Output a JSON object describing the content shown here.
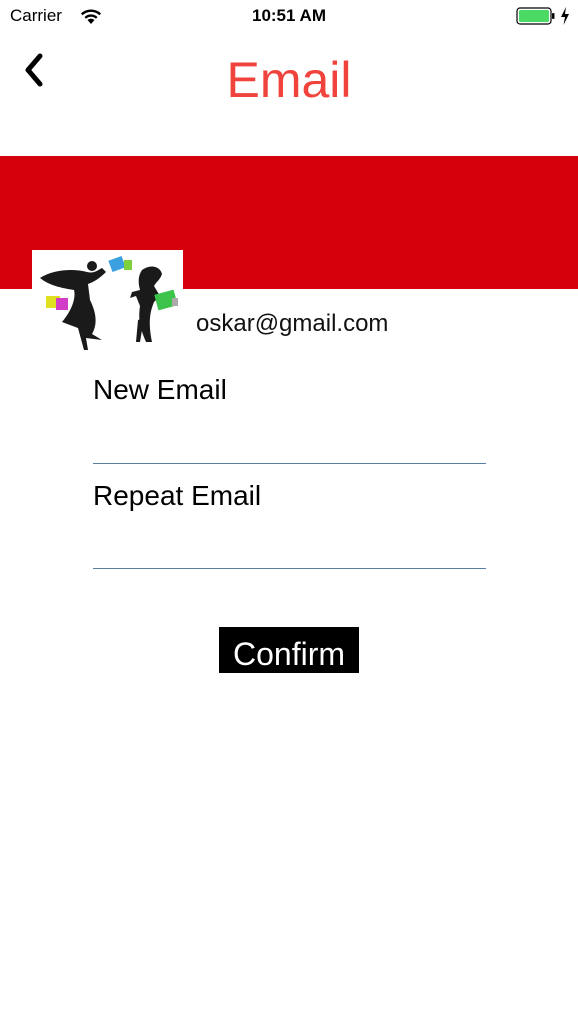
{
  "status_bar": {
    "carrier": "Carrier",
    "time": "10:51 AM",
    "wifi_icon": "wifi-icon",
    "battery_icon": "battery-icon",
    "battery_level": 1.0,
    "charging_icon": "charging-bolt-icon"
  },
  "nav": {
    "back_icon": "chevron-left-icon",
    "title": "Email"
  },
  "colors": {
    "title": "#f0433c",
    "banner": "#d5000b",
    "button_bg": "#000000",
    "button_text": "#ffffff",
    "underline": "#5a7fa3",
    "battery": "#4cd964"
  },
  "profile": {
    "avatar_icon": "shopping-women-silhouette-image",
    "current_email": "oskar@gmail.com"
  },
  "form": {
    "new_email_label": "New Email",
    "new_email_value": "",
    "repeat_email_label": "Repeat Email",
    "repeat_email_value": "",
    "confirm_label": "Confirm"
  }
}
